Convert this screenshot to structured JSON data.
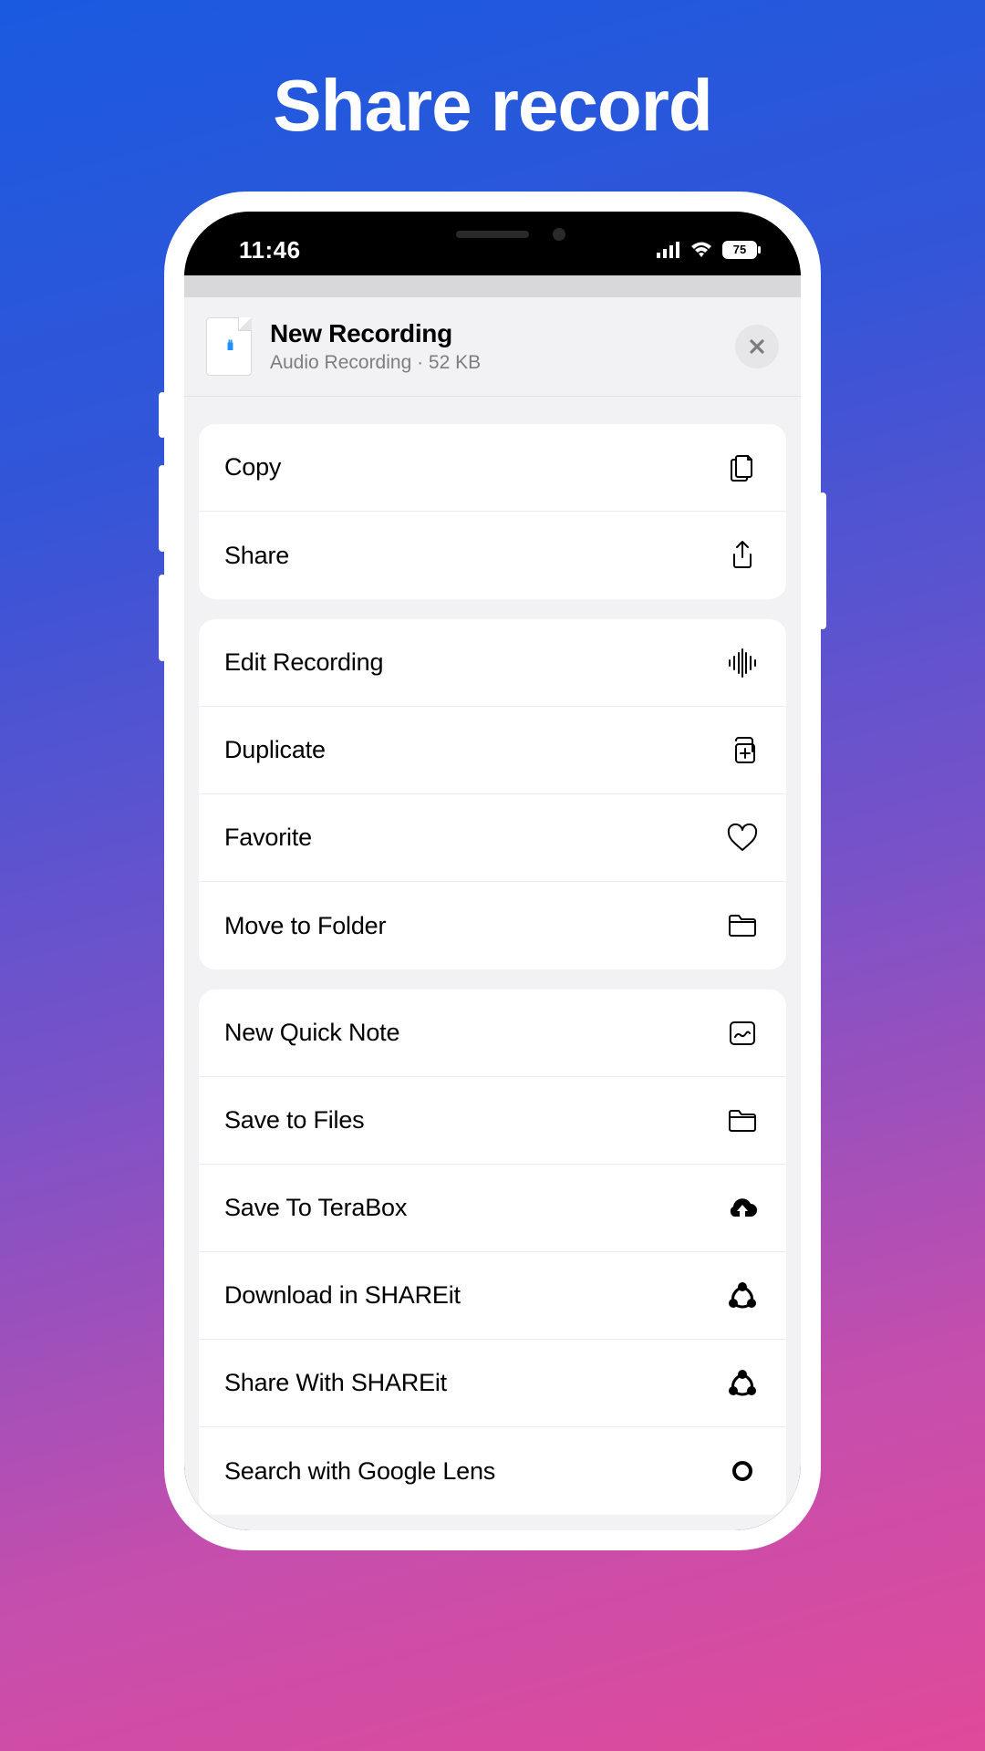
{
  "page_title": "Share record",
  "status": {
    "time": "11:46",
    "battery": "75"
  },
  "sheet": {
    "title": "New Recording",
    "subtitle": "Audio Recording · 52 KB"
  },
  "groups": [
    {
      "items": [
        {
          "label": "Copy",
          "icon": "copy-docs-icon"
        },
        {
          "label": "Share",
          "icon": "share-up-icon"
        }
      ]
    },
    {
      "items": [
        {
          "label": "Edit Recording",
          "icon": "waveform-icon"
        },
        {
          "label": "Duplicate",
          "icon": "duplicate-plus-icon"
        },
        {
          "label": "Favorite",
          "icon": "heart-icon"
        },
        {
          "label": "Move to Folder",
          "icon": "folder-icon"
        }
      ]
    },
    {
      "items": [
        {
          "label": "New Quick Note",
          "icon": "quicknote-icon"
        },
        {
          "label": "Save to Files",
          "icon": "folder-icon"
        },
        {
          "label": "Save To TeraBox",
          "icon": "cloud-up-icon"
        },
        {
          "label": "Download in SHAREit",
          "icon": "shareit-icon"
        },
        {
          "label": "Share With SHAREit",
          "icon": "shareit-icon"
        },
        {
          "label": "Search with Google Lens",
          "icon": "lens-icon"
        }
      ]
    }
  ]
}
